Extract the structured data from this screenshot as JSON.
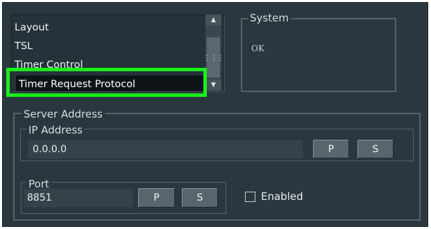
{
  "list": {
    "items": [
      "Layout",
      "TSL",
      "Timer Control",
      "Timer Request Protocol"
    ],
    "selected_index": 3
  },
  "scrollbar": {
    "up_icon": "▲",
    "down_icon": "▼",
    "grip": "⋮⋮⋮"
  },
  "system": {
    "title": "System",
    "status": "OK"
  },
  "server_address": {
    "title": "Server Address",
    "ip": {
      "title": "IP Address",
      "value": "0.0.0.0",
      "p_label": "P",
      "s_label": "S"
    },
    "port": {
      "title": "Port",
      "value": "8851",
      "p_label": "P",
      "s_label": "S"
    },
    "enabled": {
      "label": "Enabled",
      "checked": false
    }
  },
  "colors": {
    "panel_bg": "#2b373f",
    "highlight": "#19f019"
  }
}
